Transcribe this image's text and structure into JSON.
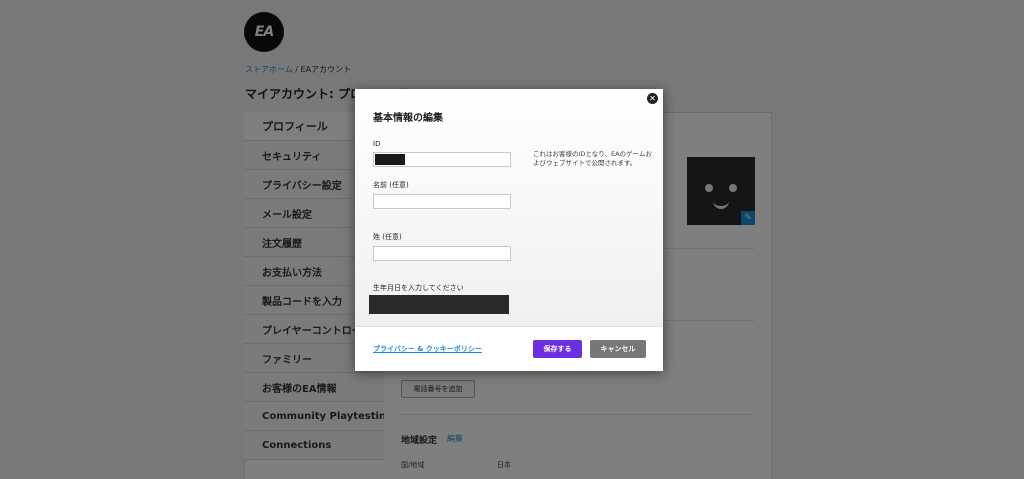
{
  "brand": {
    "logo_text": "EA"
  },
  "breadcrumb": {
    "home": "ストアホーム",
    "separator": " / ",
    "current": "EAアカウント"
  },
  "page_title": "マイアカウント: プロフィール",
  "sidebar": {
    "items": [
      {
        "label": "プロフィール",
        "active": true
      },
      {
        "label": "セキュリティ"
      },
      {
        "label": "プライバシー設定"
      },
      {
        "label": "メール設定"
      },
      {
        "label": "注文履歴"
      },
      {
        "label": "お支払い方法"
      },
      {
        "label": "製品コードを入力"
      },
      {
        "label": "プレイヤーコントロール"
      },
      {
        "label": "ファミリー"
      },
      {
        "label": "お客様のEA情報"
      },
      {
        "label": "Community Playtesting"
      },
      {
        "label": "Connections"
      }
    ]
  },
  "main": {
    "avatar_icon": "pencil-icon",
    "phone_button": "電話番号を追加",
    "region": {
      "title": "地域設定",
      "edit": "編集",
      "country_label": "国/地域",
      "country_value": "日本"
    }
  },
  "modal": {
    "title": "基本情報の編集",
    "close_glyph": "✕",
    "fields": {
      "id_label": "ID",
      "first_name_label": "名前 (任意)",
      "first_name_value": "",
      "last_name_label": "姓 (任意)",
      "last_name_value": "",
      "dob_label": "生年月日を入力してください"
    },
    "help_text": "これはお客様のIDとなり、EAのゲームおよびウェブサイトで公開されます。",
    "privacy_link": "プライバシー & クッキーポリシー",
    "save_label": "保存する",
    "cancel_label": "キャンセル"
  },
  "colors": {
    "accent_blue": "#1c8ad6",
    "save_purple": "#6c2fe0",
    "cancel_gray": "#777777"
  }
}
